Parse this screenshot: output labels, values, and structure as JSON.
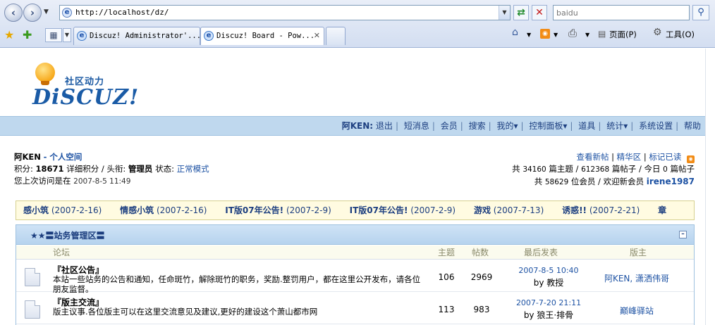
{
  "browser": {
    "url": "http://localhost/dz/",
    "search_placeholder": "baidu",
    "tabs": [
      {
        "label": "Discuz! Administrator'..."
      },
      {
        "label": "Discuz! Board - Pow..."
      }
    ],
    "commands": {
      "page": "页面(P)",
      "tools": "工具(O)"
    }
  },
  "logo": {
    "cn": "社区动力",
    "en": "DiSCUZ!"
  },
  "topnav": {
    "user": "阿KEN:",
    "items": [
      "退出",
      "短消息",
      "会员",
      "搜索",
      "我的▾",
      "控制面板▾",
      "道具",
      "统计▾",
      "系统设置",
      "帮助"
    ]
  },
  "user_panel": {
    "name": "阿KEN",
    "space_link": "- 个人空间",
    "credits_label": "积分:",
    "credits_value": "18671",
    "credits_detail": "详细积分",
    "title_label": "/ 头衔:",
    "title_value": "管理员",
    "status_label": "状态:",
    "status_value": "正常模式",
    "last_visit_label": "您上次访问是在",
    "last_visit_time": "2007-8-5 11:49"
  },
  "stats": {
    "links": [
      "查看新帖",
      "精华区",
      "标记已读"
    ],
    "total_prefix": "共",
    "topics": "34160",
    "topics_label": "篇主题 /",
    "posts": "612368",
    "posts_label": "篇帖子 / 今日",
    "today": "0",
    "today_label": "篇帖子",
    "members_prefix": "共",
    "members": "58629",
    "members_label": "位会员 / 欢迎新会员",
    "newest_member": "irene1987"
  },
  "announcements": [
    {
      "title": "感小筑",
      "date": "(2007-2-16)"
    },
    {
      "title": "情感小筑",
      "date": "(2007-2-16)"
    },
    {
      "title": "IT版07年公告!",
      "date": "(2007-2-9)"
    },
    {
      "title": "IT版07年公告!",
      "date": "(2007-2-9)"
    },
    {
      "title": "游戏",
      "date": "(2007-7-13)"
    },
    {
      "title": "诱惑!!",
      "date": "(2007-2-21)"
    },
    {
      "title": "章",
      "date": ""
    }
  ],
  "category": {
    "title": "★★〓站务管理区〓",
    "columns": {
      "forum": "论坛",
      "topics": "主题",
      "posts": "帖数",
      "last_post": "最后发表",
      "moderators": "版主"
    },
    "forums": [
      {
        "name": "『社区公告』",
        "desc": "本站一些站务的公告和通知，任命斑竹，解除斑竹的职务，奖励.整罚用户，都在这里公开发布，请各位朋友监督。",
        "topics": "106",
        "posts": "2969",
        "last_time": "2007-8-5 10:40",
        "last_by": "by",
        "last_user": "教授",
        "moderators": "阿KEN, 潇洒伟哥"
      },
      {
        "name": "『版主交流』",
        "desc": "版主议事.各位版主可以在这里交流意见及建议,更好的建设这个萧山都市网",
        "topics": "113",
        "posts": "983",
        "last_time": "2007-7-20 21:11",
        "last_by": "by",
        "last_user": "狼王·排骨",
        "moderators": "巅峰驿站"
      }
    ]
  }
}
